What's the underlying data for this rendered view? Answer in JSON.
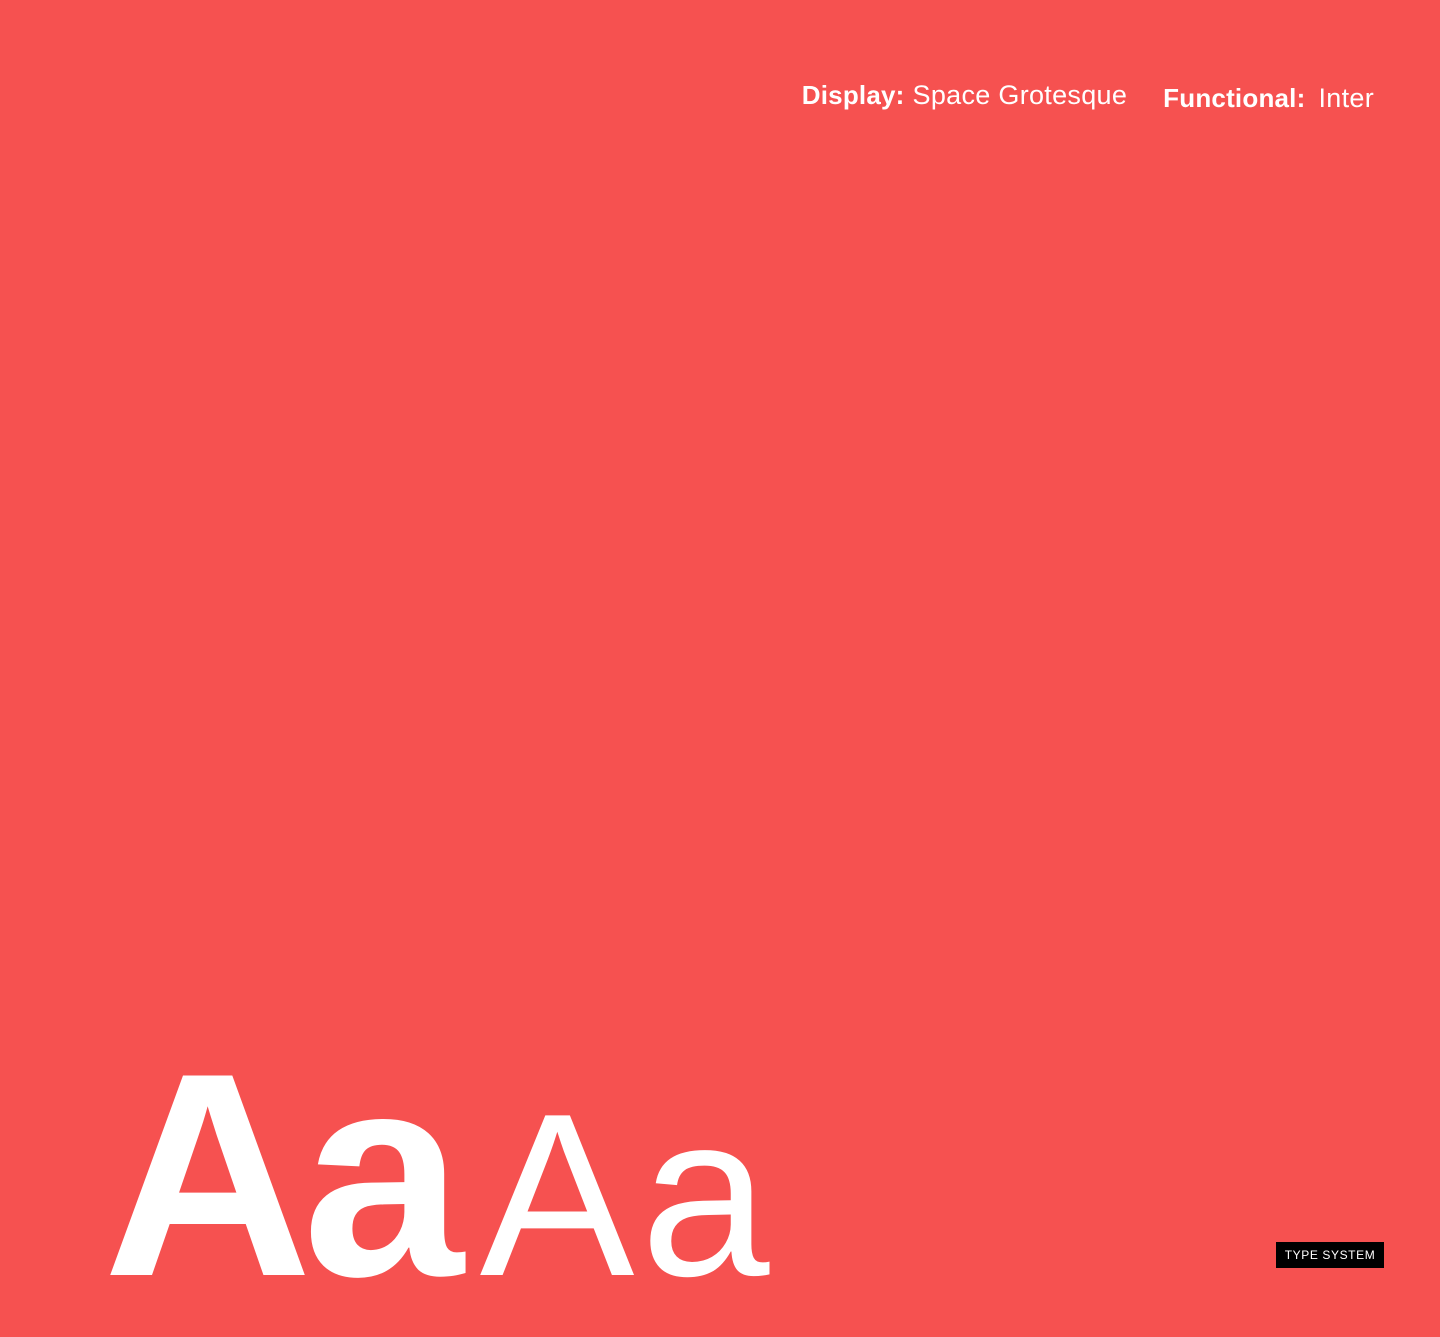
{
  "colors": {
    "background": "#f65150",
    "text": "#ffffff",
    "tag_background": "#000000"
  },
  "fonts": {
    "display": {
      "label": "Display:",
      "name": "Space Grotesque"
    },
    "functional": {
      "label": "Functional:",
      "name": "Inter"
    }
  },
  "specimen": {
    "display_sample": "Aa",
    "functional_sample": "Aa"
  },
  "tag": {
    "label": "TYPE SYSTEM"
  }
}
